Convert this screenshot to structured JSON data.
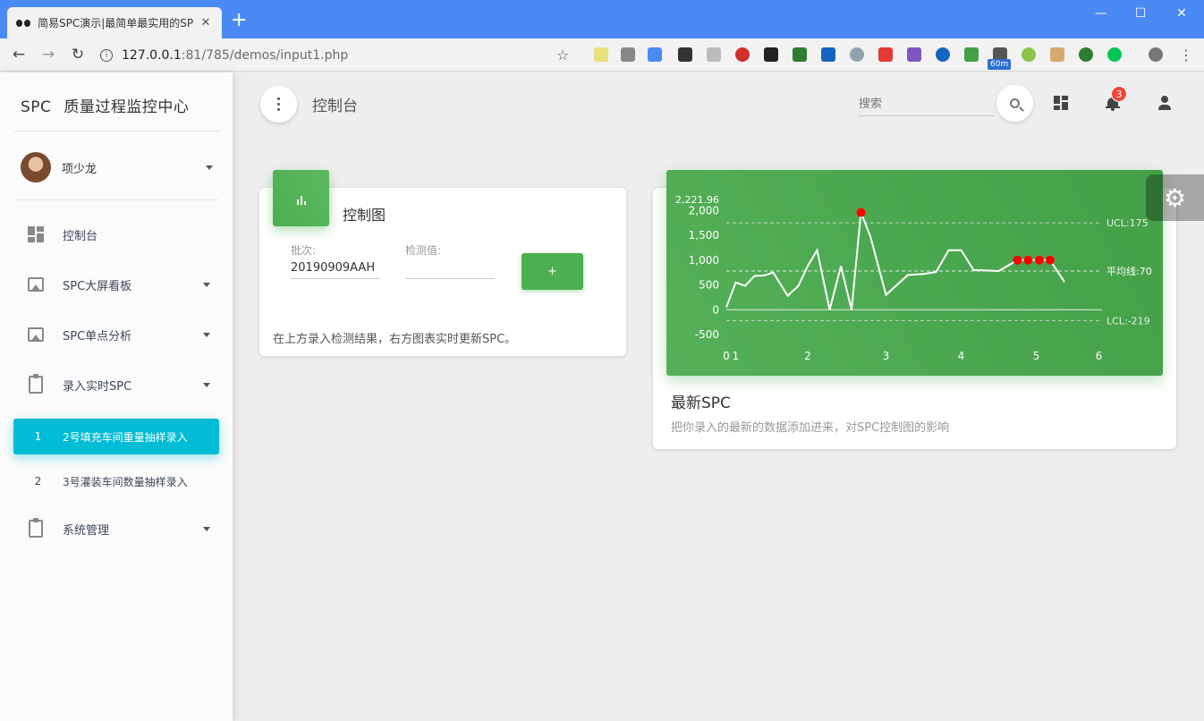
{
  "browser": {
    "tab_title": "简易SPC演示|最简单最实用的SP",
    "url_host": "127.0.0.1",
    "url_path": ":81/785/demos/input1.php",
    "ext_badge": "60m"
  },
  "sidebar": {
    "logo_mini": "SPC",
    "logo_text": "质量过程监控中心",
    "user_name": "项少龙",
    "items": [
      {
        "label": "控制台",
        "icon": "dashboard-icon"
      },
      {
        "label": "SPC大屏看板",
        "icon": "image-icon"
      },
      {
        "label": "SPC单点分析",
        "icon": "image-icon"
      },
      {
        "label": "录入实时SPC",
        "icon": "clipboard-icon"
      },
      {
        "label": "系统管理",
        "icon": "clipboard-icon"
      }
    ],
    "sub_items": [
      {
        "num": "1",
        "label": "2号填充车间重量抽样录入"
      },
      {
        "num": "2",
        "label": "3号灌装车间数量抽样录入"
      }
    ]
  },
  "navbar": {
    "title": "控制台",
    "search_placeholder": "搜索",
    "notification_count": "3"
  },
  "control_card": {
    "title": "控制图",
    "batch_label": "批次:",
    "batch_value": "20190909AAH",
    "value_label": "检测值:",
    "value_value": "",
    "add_button": "+",
    "footer": "在上方录入检测结果，右方图表实时更新SPC。"
  },
  "chart_card": {
    "title": "最新SPC",
    "subtitle": "把你录入的最新的数据添加进来，对SPC控制图的影响"
  },
  "colors": {
    "accent_cyan": "#00bcd4",
    "chart_green": "#4caf50",
    "alert_red": "#f44336",
    "out_of_control_point": "#ff0000"
  },
  "chart_data": {
    "type": "line",
    "title": "",
    "xlabel": "",
    "ylabel": "",
    "ylim": [
      -500,
      2221.96
    ],
    "y_top_tick": "2,221.96",
    "y_ticks": [
      "2,000",
      "1,500",
      "1,000",
      "500",
      "0",
      "-500"
    ],
    "x_ticks": [
      "0",
      "1",
      "2",
      "3",
      "4",
      "5",
      "6"
    ],
    "ucl_label": "UCL:175",
    "mean_label": "平均线:70",
    "lcl_label": "LCL:-219",
    "ucl": 1750,
    "mean": 780,
    "lcl": -219,
    "points": [
      [
        0.0,
        50
      ],
      [
        0.15,
        550
      ],
      [
        0.3,
        480
      ],
      [
        0.45,
        680
      ],
      [
        0.6,
        690
      ],
      [
        0.75,
        750
      ],
      [
        0.98,
        280
      ],
      [
        1.15,
        480
      ],
      [
        1.3,
        880
      ],
      [
        1.45,
        1200
      ],
      [
        1.65,
        0
      ],
      [
        1.83,
        880
      ],
      [
        2.0,
        0
      ],
      [
        2.15,
        1960
      ],
      [
        2.3,
        1480
      ],
      [
        2.55,
        300
      ],
      [
        2.9,
        700
      ],
      [
        3.15,
        720
      ],
      [
        3.35,
        760
      ],
      [
        3.55,
        1200
      ],
      [
        3.75,
        1200
      ],
      [
        3.95,
        800
      ],
      [
        4.15,
        790
      ],
      [
        4.35,
        780
      ],
      [
        4.65,
        1000
      ],
      [
        4.82,
        1000
      ],
      [
        5.0,
        1000
      ],
      [
        5.17,
        1000
      ],
      [
        5.4,
        560
      ]
    ],
    "highlight_x": [
      2.15,
      4.65,
      4.82,
      5.0,
      5.17
    ],
    "grid": false
  }
}
